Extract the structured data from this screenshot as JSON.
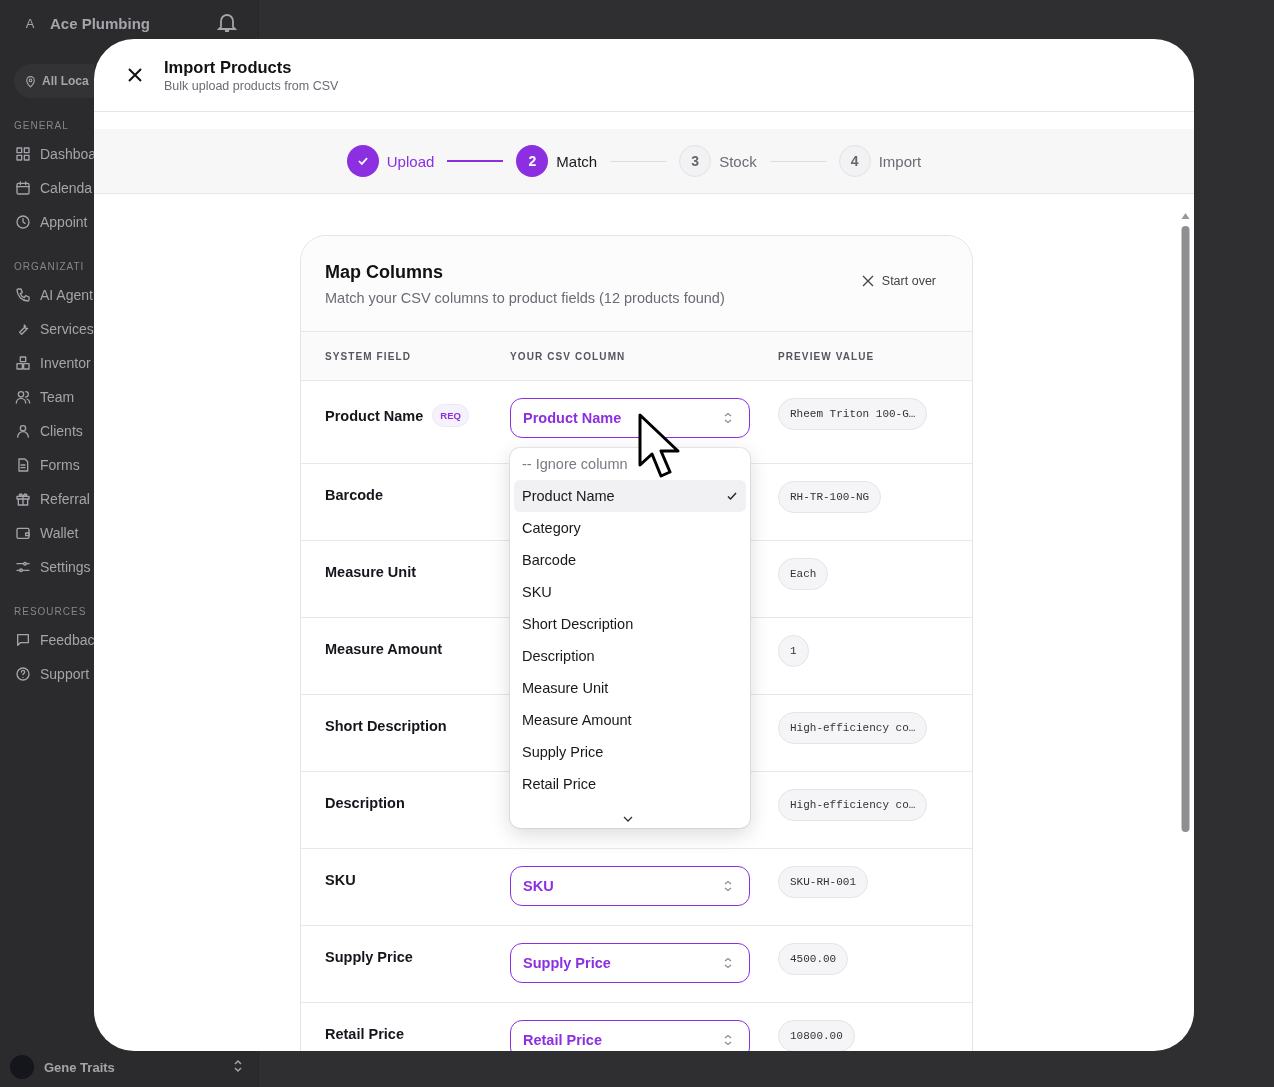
{
  "sidebar": {
    "workspace": {
      "initial": "A",
      "name": "Ace Plumbing"
    },
    "location": "All Loca",
    "sections": [
      {
        "heading": "GENERAL",
        "items": [
          {
            "label": "Dashboa"
          },
          {
            "label": "Calenda"
          },
          {
            "label": "Appoint"
          }
        ]
      },
      {
        "heading": "ORGANIZATI",
        "items": [
          {
            "label": "AI Agent"
          },
          {
            "label": "Services"
          },
          {
            "label": "Inventor"
          },
          {
            "label": "Team"
          },
          {
            "label": "Clients"
          },
          {
            "label": "Forms"
          },
          {
            "label": "Referral"
          },
          {
            "label": "Wallet"
          },
          {
            "label": "Settings"
          }
        ]
      },
      {
        "heading": "RESOURCES",
        "items": [
          {
            "label": "Feedbac"
          },
          {
            "label": "Support"
          }
        ]
      }
    ],
    "user": {
      "name": "Gene Traits"
    }
  },
  "modal": {
    "title": "Import Products",
    "subtitle": "Bulk upload products from CSV",
    "steps": [
      {
        "label": "Upload",
        "done": true,
        "selected": false
      },
      {
        "label": "Match",
        "number": "2",
        "done": false,
        "selected": true
      },
      {
        "label": "Stock",
        "number": "3",
        "done": false,
        "selected": false
      },
      {
        "label": "Import",
        "number": "4",
        "done": false,
        "selected": false
      }
    ],
    "card": {
      "title": "Map Columns",
      "subtitle": "Match your CSV columns to product fields (12 products found)",
      "start_over": "Start over",
      "columns": [
        "SYSTEM FIELD",
        "YOUR CSV COLUMN",
        "PREVIEW VALUE"
      ],
      "rows": [
        {
          "field": "Product Name",
          "badge": "REQ",
          "mapping": "Product Name",
          "preview": "Rheem Triton 100-G…"
        },
        {
          "field": "Barcode",
          "preview": "RH-TR-100-NG"
        },
        {
          "field": "Measure Unit",
          "preview": "Each"
        },
        {
          "field": "Measure Amount",
          "preview": "1"
        },
        {
          "field": "Short Description",
          "preview": "High-efficiency co…"
        },
        {
          "field": "Description",
          "preview": "High-efficiency co…"
        },
        {
          "field": "SKU",
          "mapping": "SKU",
          "preview": "SKU-RH-001"
        },
        {
          "field": "Supply Price",
          "mapping": "Supply Price",
          "preview": "4500.00"
        },
        {
          "field": "Retail Price",
          "mapping": "Retail Price",
          "preview": "10800.00"
        }
      ],
      "dropdown": {
        "options": [
          {
            "label": "-- Ignore column",
            "kind": "ignore",
            "selected": false
          },
          {
            "label": "Product Name",
            "kind": "field",
            "selected": true
          },
          {
            "label": "Category",
            "kind": "field",
            "selected": false
          },
          {
            "label": "Barcode",
            "kind": "field",
            "selected": false
          },
          {
            "label": "SKU",
            "kind": "field",
            "selected": false
          },
          {
            "label": "Short Description",
            "kind": "field",
            "selected": false
          },
          {
            "label": "Description",
            "kind": "field",
            "selected": false
          },
          {
            "label": "Measure Unit",
            "kind": "field",
            "selected": false
          },
          {
            "label": "Measure Amount",
            "kind": "field",
            "selected": false
          },
          {
            "label": "Supply Price",
            "kind": "field",
            "selected": false
          },
          {
            "label": "Retail Price",
            "kind": "field",
            "selected": false
          }
        ]
      }
    }
  }
}
